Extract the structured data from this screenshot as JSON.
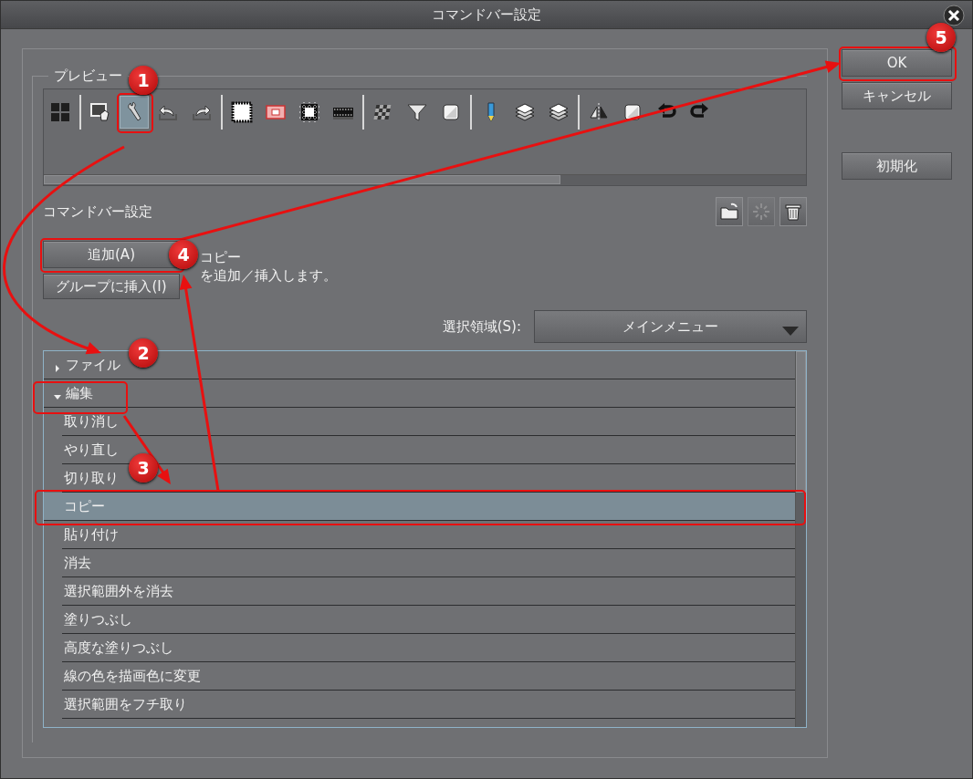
{
  "window": {
    "title": "コマンドバー設定"
  },
  "preview": {
    "label": "プレビュー",
    "icons": [
      {
        "kind": "grid",
        "selected": false
      },
      {
        "kind": "separator"
      },
      {
        "kind": "picture-hand",
        "selected": false
      },
      {
        "kind": "wrench",
        "selected": true
      },
      {
        "kind": "undo-tray",
        "selected": false
      },
      {
        "kind": "redo-tray",
        "selected": false
      },
      {
        "kind": "separator"
      },
      {
        "kind": "dotted-frame",
        "selected": false
      },
      {
        "kind": "photo-frame",
        "selected": false
      },
      {
        "kind": "chip",
        "selected": false
      },
      {
        "kind": "strip",
        "selected": false
      },
      {
        "kind": "separator"
      },
      {
        "kind": "mosaic",
        "selected": false
      },
      {
        "kind": "funnel",
        "selected": false
      },
      {
        "kind": "square",
        "selected": false
      },
      {
        "kind": "separator"
      },
      {
        "kind": "pencil",
        "selected": false
      },
      {
        "kind": "layers",
        "selected": false
      },
      {
        "kind": "layers",
        "selected": false
      },
      {
        "kind": "separator"
      },
      {
        "kind": "flip",
        "selected": false
      },
      {
        "kind": "square",
        "selected": false
      },
      {
        "kind": "undo-arrow",
        "selected": false
      },
      {
        "kind": "redo-arrow",
        "selected": false
      }
    ]
  },
  "command_bar": {
    "label": "コマンドバー設定",
    "tools": [
      {
        "kind": "folder",
        "disabled": false
      },
      {
        "kind": "spinner",
        "disabled": true
      },
      {
        "kind": "trash",
        "disabled": false
      }
    ]
  },
  "actions": {
    "buttons": [
      "追加(A)",
      "グループに挿入(I)"
    ],
    "description": [
      "コピー",
      "を追加／挿入します。"
    ]
  },
  "selection_area": {
    "label": "選択領域(S):",
    "value": "メインメニュー"
  },
  "tree": [
    {
      "label": "ファイル",
      "expanded": false,
      "selected": false
    },
    {
      "label": "編集",
      "expanded": true,
      "selected": false,
      "children": [
        {
          "label": "取り消し",
          "selected": false
        },
        {
          "label": "やり直し",
          "selected": false
        },
        {
          "label": "切り取り",
          "selected": false
        },
        {
          "label": "コピー",
          "selected": true
        },
        {
          "label": "貼り付け",
          "selected": false
        },
        {
          "label": "消去",
          "selected": false
        },
        {
          "label": "選択範囲外を消去",
          "selected": false
        },
        {
          "label": "塗りつぶし",
          "selected": false
        },
        {
          "label": "高度な塗りつぶし",
          "selected": false
        },
        {
          "label": "線の色を描画色に変更",
          "selected": false
        },
        {
          "label": "選択範囲をフチ取り",
          "selected": false
        }
      ]
    }
  ],
  "dialog_buttons": [
    "OK",
    "キャンセル",
    "初期化"
  ],
  "annotations": {
    "steps": [
      "1",
      "2",
      "3",
      "4",
      "5"
    ]
  }
}
